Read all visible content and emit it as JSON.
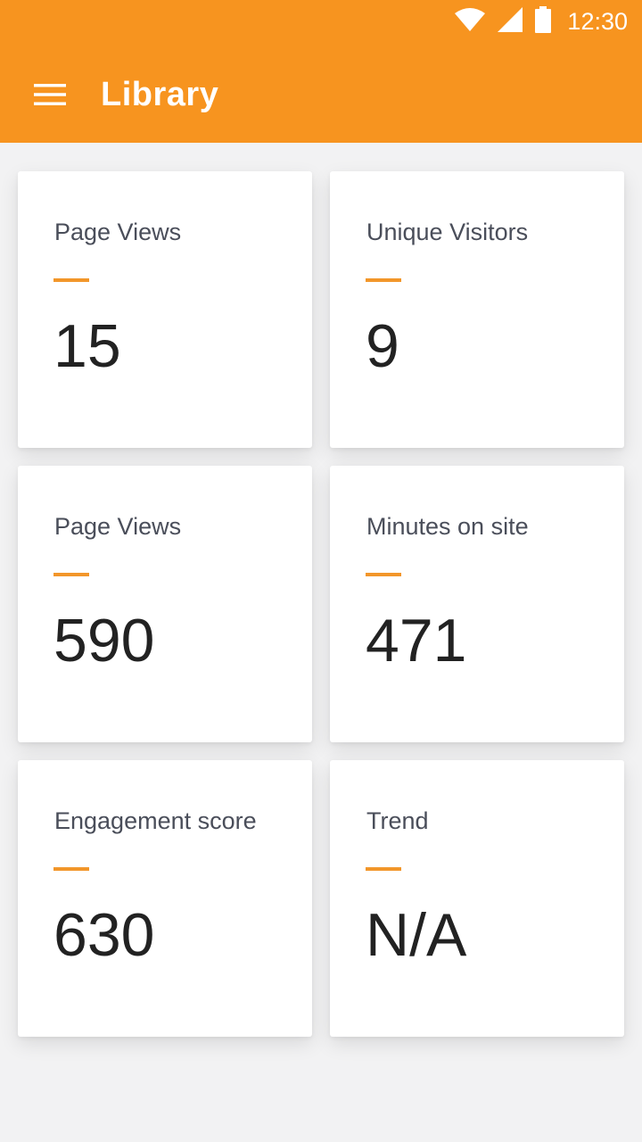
{
  "status_bar": {
    "time": "12:30",
    "icons": [
      "wifi-icon",
      "cell-signal-icon",
      "battery-icon"
    ]
  },
  "app_bar": {
    "title": "Library",
    "menu_icon": "hamburger-menu-icon",
    "color": "#f7941f"
  },
  "cards": [
    {
      "label": "Page Views",
      "value": "15"
    },
    {
      "label": "Unique Visitors",
      "value": "9"
    },
    {
      "label": "Page Views",
      "value": "590"
    },
    {
      "label": "Minutes on site",
      "value": "471"
    },
    {
      "label": "Engagement score",
      "value": "630"
    },
    {
      "label": "Trend",
      "value": "N/A"
    }
  ],
  "colors": {
    "accent": "#f7941f",
    "background": "#f2f2f3",
    "card": "#ffffff",
    "label_text": "#4a4e5a",
    "value_text": "#222222"
  }
}
